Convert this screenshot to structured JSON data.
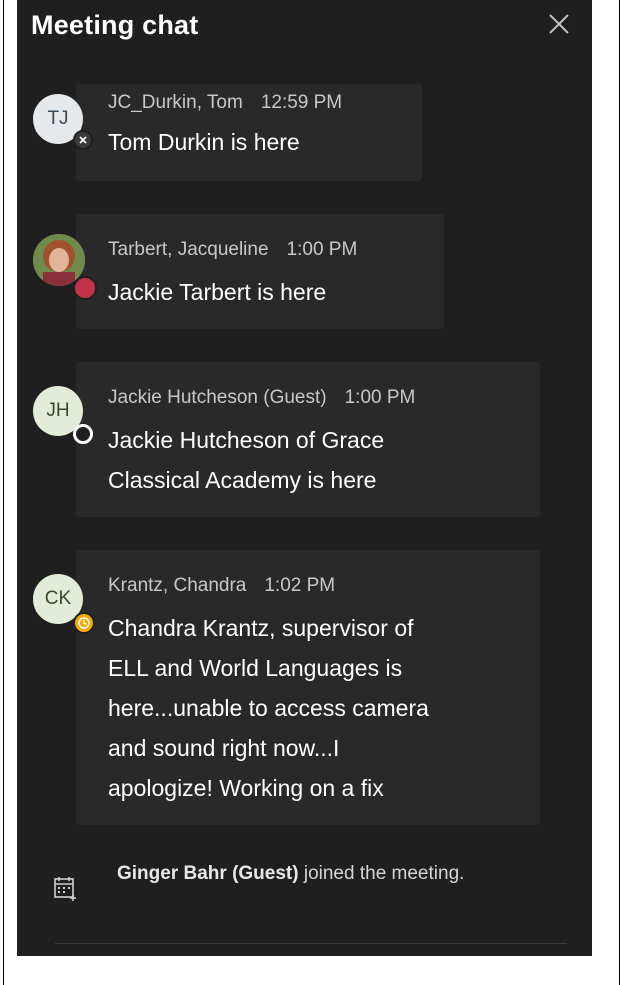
{
  "header": {
    "title": "Meeting chat"
  },
  "messages": [
    {
      "initials": "TJ",
      "sender": "JC_Durkin, Tom",
      "time": "12:59 PM",
      "lines": [
        "Tom Durkin is here"
      ]
    },
    {
      "initials": "",
      "sender": "Tarbert, Jacqueline",
      "time": "1:00 PM",
      "lines": [
        "Jackie Tarbert is here"
      ]
    },
    {
      "initials": "JH",
      "sender": "Jackie Hutcheson (Guest)",
      "time": "1:00 PM",
      "lines": [
        "Jackie Hutcheson of Grace",
        "Classical Academy is here"
      ]
    },
    {
      "initials": "CK",
      "sender": "Krantz, Chandra",
      "time": "1:02 PM",
      "lines": [
        "Chandra Krantz, supervisor of",
        "ELL and World Languages is",
        "here...unable to access camera",
        "and sound right now...I",
        "apologize! Working on a fix"
      ]
    }
  ],
  "system_event": {
    "name": "Ginger Bahr (Guest)",
    "text": " joined the meeting."
  },
  "colors": {
    "panel": "#1f1f1f",
    "bubble": "#292929",
    "busy": "#c4314b",
    "away": "#f8a800"
  },
  "icons": {
    "close": "close-icon",
    "join": "calendar-add-icon"
  }
}
